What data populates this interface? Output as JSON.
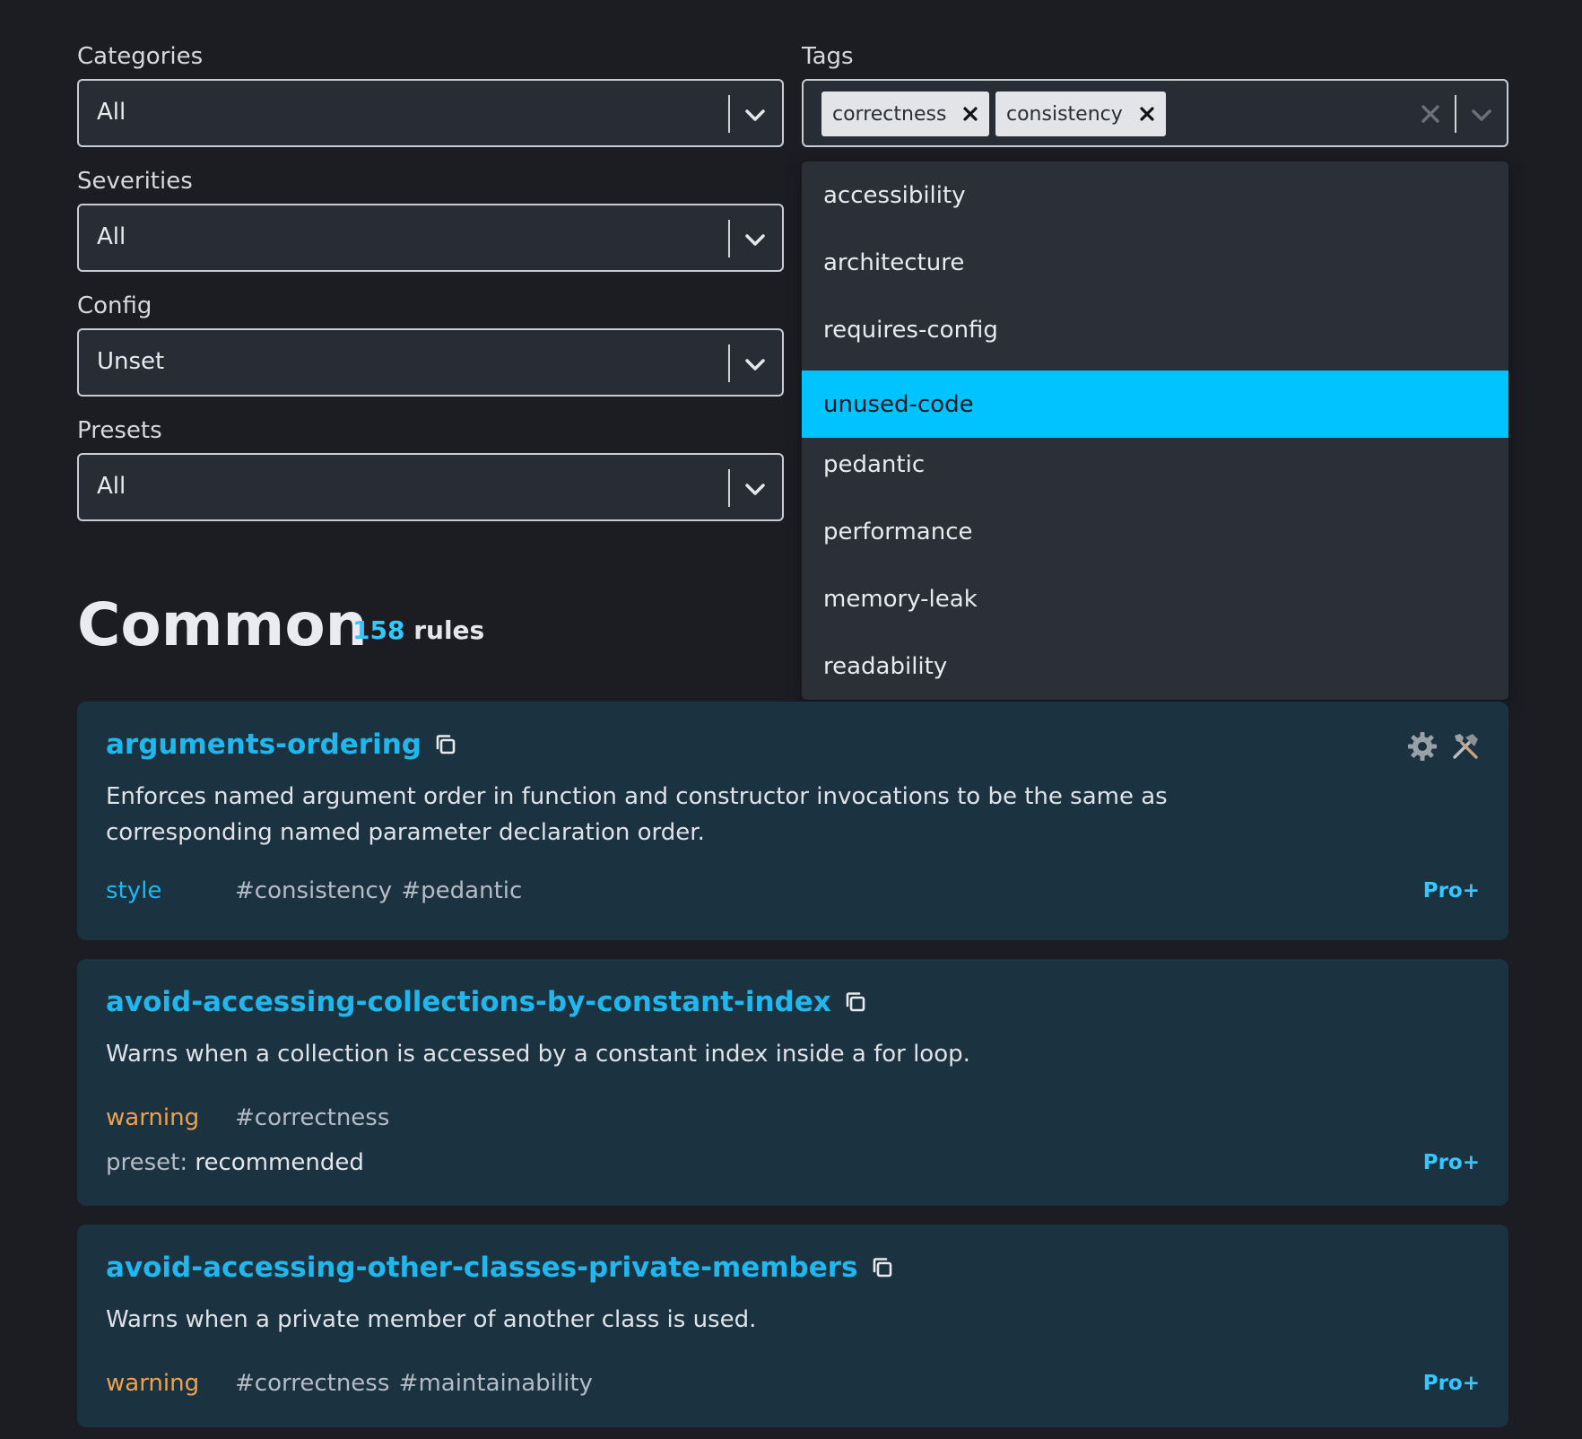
{
  "filters": {
    "categories": {
      "label": "Categories",
      "value": "All"
    },
    "severities": {
      "label": "Severities",
      "value": "All"
    },
    "config": {
      "label": "Config",
      "value": "Unset"
    },
    "presets": {
      "label": "Presets",
      "value": "All"
    },
    "tags": {
      "label": "Tags",
      "selected": [
        "correctness",
        "consistency"
      ],
      "options": [
        "accessibility",
        "architecture",
        "requires-config",
        "unused-code",
        "pedantic",
        "performance",
        "memory-leak",
        "readability"
      ],
      "highlighted": "unused-code"
    }
  },
  "section": {
    "title": "Common",
    "count": "158",
    "count_word": "rules"
  },
  "rules": [
    {
      "name": "arguments-ordering",
      "description": "Enforces named argument order in function and constructor invocations to be the same as corresponding named parameter declaration order.",
      "severity": "style",
      "tags": "#consistency #pedantic",
      "badge": "Pro+",
      "icons": [
        "gear-icon",
        "tools-icon"
      ]
    },
    {
      "name": "avoid-accessing-collections-by-constant-index",
      "description": "Warns when a collection is accessed by a constant index inside a for loop.",
      "severity": "warning",
      "tags": "#correctness",
      "preset_label": "preset:",
      "preset_value": "recommended",
      "badge": "Pro+"
    },
    {
      "name": "avoid-accessing-other-classes-private-members",
      "description": "Warns when a private member of another class is used.",
      "severity": "warning",
      "tags": "#correctness #maintainability",
      "badge": "Pro+"
    }
  ],
  "colors": {
    "accent": "#00c3ff",
    "link": "#1fb8ee",
    "warning": "#f0a24b",
    "card_bg": "#1b3240",
    "page_bg": "#1b1d22"
  }
}
